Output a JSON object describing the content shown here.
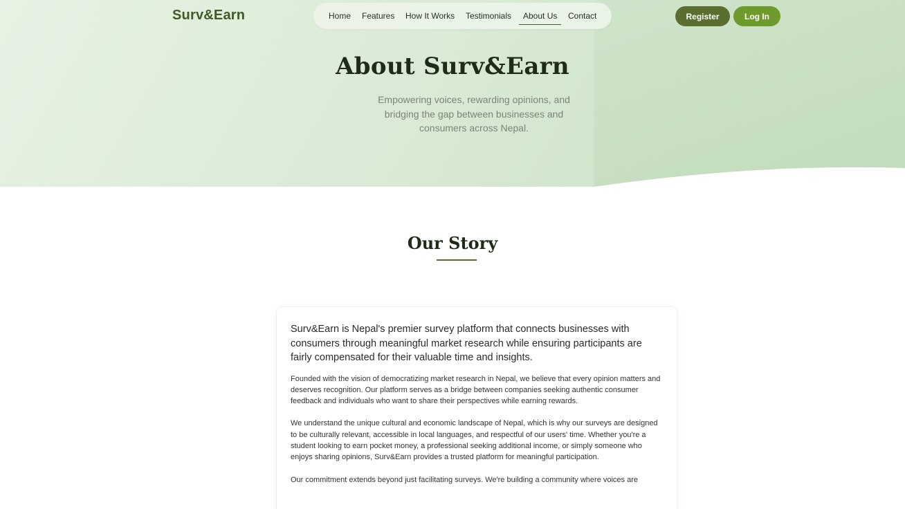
{
  "brand": {
    "name": "Surv&Earn"
  },
  "nav": {
    "items": [
      "Home",
      "Features",
      "How It Works",
      "Testimonials",
      "About Us",
      "Contact"
    ],
    "active": "About Us"
  },
  "auth": {
    "register_label": "Register",
    "login_label": "Log In"
  },
  "hero": {
    "title": "About Surv&Earn",
    "subtitle": "Empowering voices, rewarding opinions, and bridging the gap between businesses and consumers across Nepal."
  },
  "story": {
    "title": "Our Story",
    "lead": "Surv&Earn is Nepal's premier survey platform that connects businesses with consumers through meaningful market research while ensuring participants are fairly compensated for their valuable time and insights.",
    "paragraphs": [
      "Founded with the vision of democratizing market research in Nepal, we believe that every opinion matters and deserves recognition. Our platform serves as a bridge between companies seeking authentic consumer feedback and individuals who want to share their perspectives while earning rewards.",
      "We understand the unique cultural and economic landscape of Nepal, which is why our surveys are designed to be culturally relevant, accessible in local languages, and respectful of our users' time. Whether you're a student looking to earn pocket money, a professional seeking additional income, or simply someone who enjoys sharing opinions, Surv&Earn provides a trusted platform for meaningful participation.",
      "Our commitment extends beyond just facilitating surveys. We're building a community where voices are"
    ]
  },
  "colors": {
    "brand_green": "#3f5b25",
    "register_bg": "#5a6f2f",
    "login_bg": "#6e9a2c",
    "hero_bg": "#dcebd8"
  }
}
